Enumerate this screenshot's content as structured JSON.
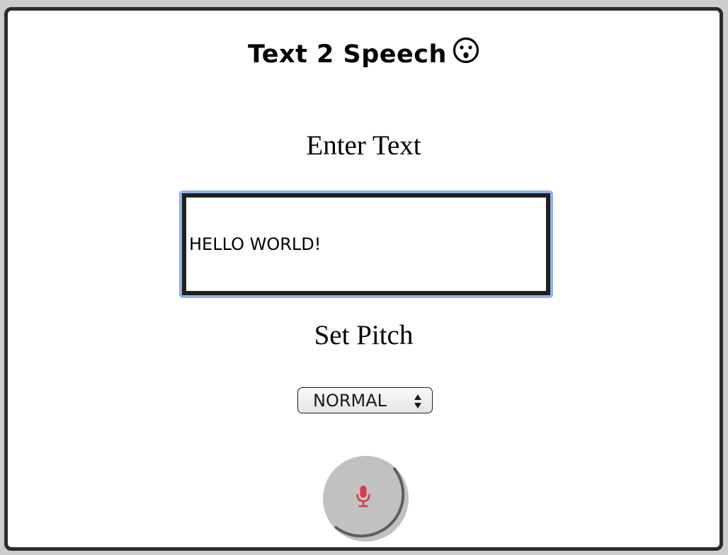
{
  "app": {
    "title": "Text 2 Speech",
    "title_emoji": "surprised-face-icon"
  },
  "text_section": {
    "label": "Enter Text",
    "input_value": "HELLO WORLD!"
  },
  "pitch_section": {
    "label": "Set Pitch",
    "selected": "NORMAL"
  },
  "mic_button": {
    "icon": "microphone-icon",
    "icon_color": "#d63b4b",
    "background": "#c1c1c1"
  },
  "colors": {
    "card_border": "#2c2c2c",
    "focus_ring": "#8fb2ec",
    "page_bg": "#cdcdcd"
  }
}
